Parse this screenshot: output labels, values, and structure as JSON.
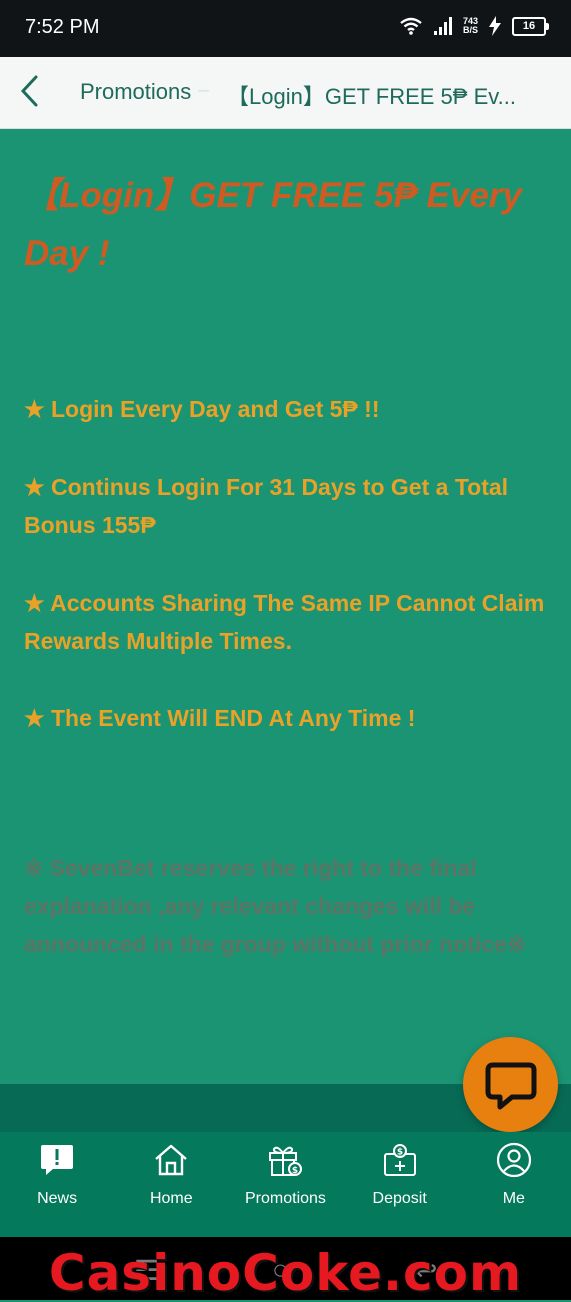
{
  "status_bar": {
    "time": "7:52 PM",
    "net_speed_value": "743",
    "net_speed_unit": "B/S",
    "battery": "16"
  },
  "app_bar": {
    "breadcrumb_home": "Promotions",
    "breadcrumb_current": "【Login】GET FREE 5₱ Ev..."
  },
  "promotion": {
    "title": "【Login】GET FREE 5₱ Every Day !",
    "rules": [
      "★ Login Every Day and Get 5₱ !!",
      "★ Continus Login For 31 Days to Get a Total Bonus 155₱",
      "★ Accounts Sharing The Same IP Cannot Claim Rewards Multiple Times.",
      "★ The Event Will END At Any Time !"
    ],
    "disclaimer": "※ SevenBet reserves the right to the final explanation ,any relevant changes will be announced in the group without prior notice※"
  },
  "tab_bar": {
    "items": [
      {
        "label": "News",
        "icon": "news-icon"
      },
      {
        "label": "Home",
        "icon": "home-icon"
      },
      {
        "label": "Promotions",
        "icon": "gift-icon"
      },
      {
        "label": "Deposit",
        "icon": "deposit-icon"
      },
      {
        "label": "Me",
        "icon": "user-icon"
      }
    ]
  },
  "watermark": "CasinoCoke.com",
  "colors": {
    "content_bg": "#1b9473",
    "tab_bar_bg": "#04795b",
    "title_color": "#d05b22",
    "rule_color": "#e9a227",
    "chat_button": "#e7800f"
  }
}
